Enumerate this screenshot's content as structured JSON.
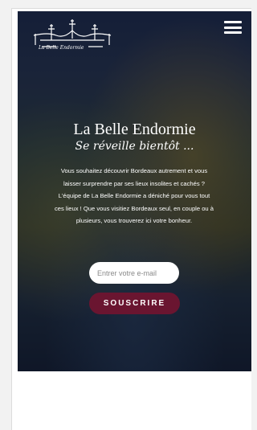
{
  "header": {
    "logo_script": "La Belle Endormie",
    "menu_icon": "hamburger-menu-icon"
  },
  "hero": {
    "title": "La Belle Endormie",
    "subtitle": "Se réveille bientôt ...",
    "description": "Vous souhaitez découvrir Bordeaux autrement et vous laisser surprendre par ses lieux insolites et cachés ? L'équipe de La Belle Endormie a déniché pour vous tout ces lieux ! Que vous visitiez Bordeaux seul, en couple ou à plusieurs, vous trouverez ici votre bonheur."
  },
  "signup": {
    "email_placeholder": "Entrer votre e-mail",
    "subscribe_label": "SOUSCRIRE"
  },
  "colors": {
    "accent": "#6a1530",
    "overlay": "#1c2848"
  }
}
